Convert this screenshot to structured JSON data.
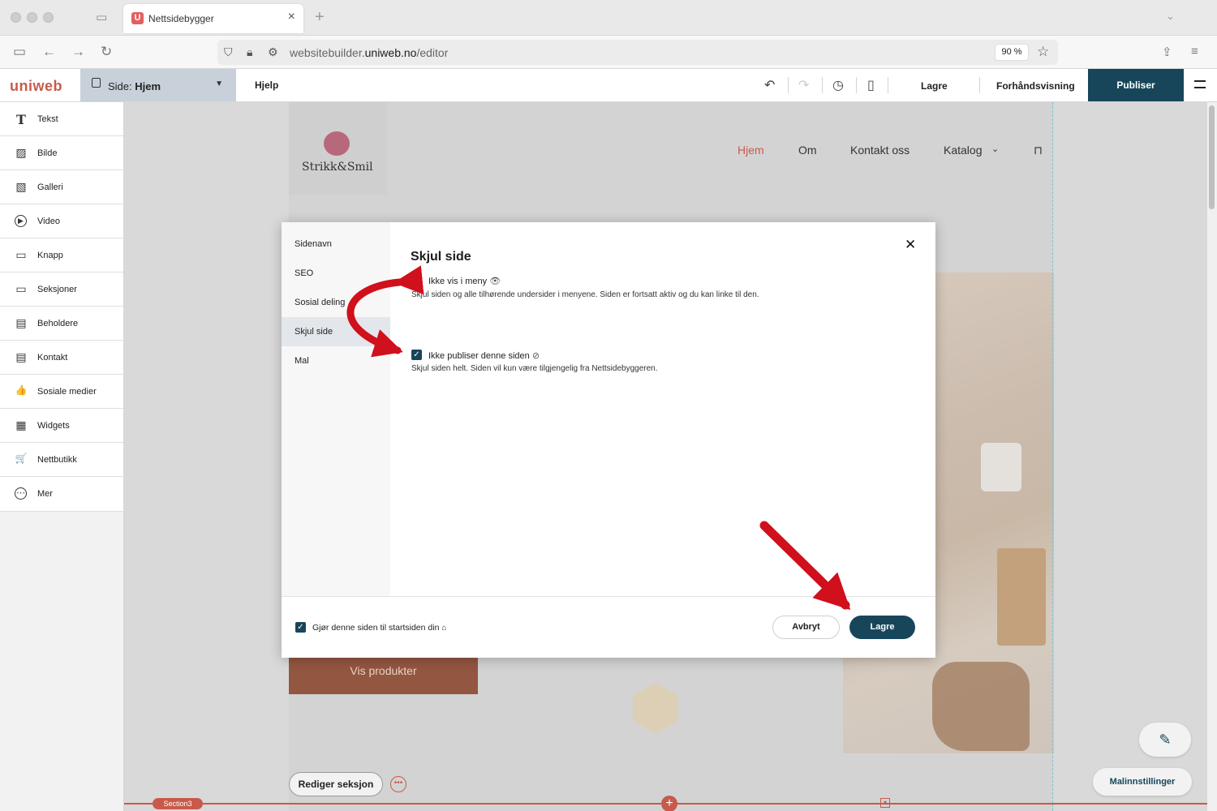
{
  "browser": {
    "tab_title": "Nettsidebygger",
    "favicon_letter": "U",
    "url_prefix": "websitebuilder.",
    "url_domain": "uniweb.no",
    "url_path": "/editor",
    "zoom": "90 %"
  },
  "toolbar": {
    "logo": "uniweb",
    "page_prefix": "Side: ",
    "page_name": "Hjem",
    "help": "Hjelp",
    "save": "Lagre",
    "preview": "Forhåndsvisning",
    "publish": "Publiser"
  },
  "sidebar": {
    "items": [
      {
        "label": "Tekst",
        "icon": "T"
      },
      {
        "label": "Bilde",
        "icon": "▨"
      },
      {
        "label": "Galleri",
        "icon": "▧"
      },
      {
        "label": "Video",
        "icon": "▶"
      },
      {
        "label": "Knapp",
        "icon": "▭"
      },
      {
        "label": "Seksjoner",
        "icon": "▭"
      },
      {
        "label": "Beholdere",
        "icon": "▤"
      },
      {
        "label": "Kontakt",
        "icon": "▤"
      },
      {
        "label": "Sosiale medier",
        "icon": "👍"
      },
      {
        "label": "Widgets",
        "icon": "▦"
      },
      {
        "label": "Nettbutikk",
        "icon": "🛒"
      },
      {
        "label": "Mer",
        "icon": "⋯"
      }
    ]
  },
  "site": {
    "brand": "Strikk&Smil",
    "nav": [
      "Hjem",
      "Om",
      "Kontakt oss",
      "Katalog"
    ],
    "cta": "Vis produkter",
    "active_nav_color": "#c85a4b"
  },
  "editor": {
    "edit_section": "Rediger seksjon",
    "section_tag": "Section3",
    "template_settings": "Malinnstillinger"
  },
  "modal": {
    "nav": [
      "Sidenavn",
      "SEO",
      "Sosial deling",
      "Skjul side",
      "Mal"
    ],
    "active_nav": "Skjul side",
    "title": "Skjul side",
    "option1_label": "Ikke vis i meny",
    "option1_desc": "Skjul siden og alle tilhørende undersider i menyene. Siden er fortsatt aktiv og du kan linke til den.",
    "option2_label": "Ikke publiser denne siden",
    "option2_desc": "Skjul siden helt. Siden vil kun være tilgjengelig fra Nettsidebyggeren.",
    "startpage_label": "Gjør denne siden til startsiden din",
    "cancel": "Avbryt",
    "save": "Lagre"
  },
  "colors": {
    "primary": "#17465b",
    "accent": "#c85a4b",
    "annotation_arrow": "#d0101c"
  }
}
